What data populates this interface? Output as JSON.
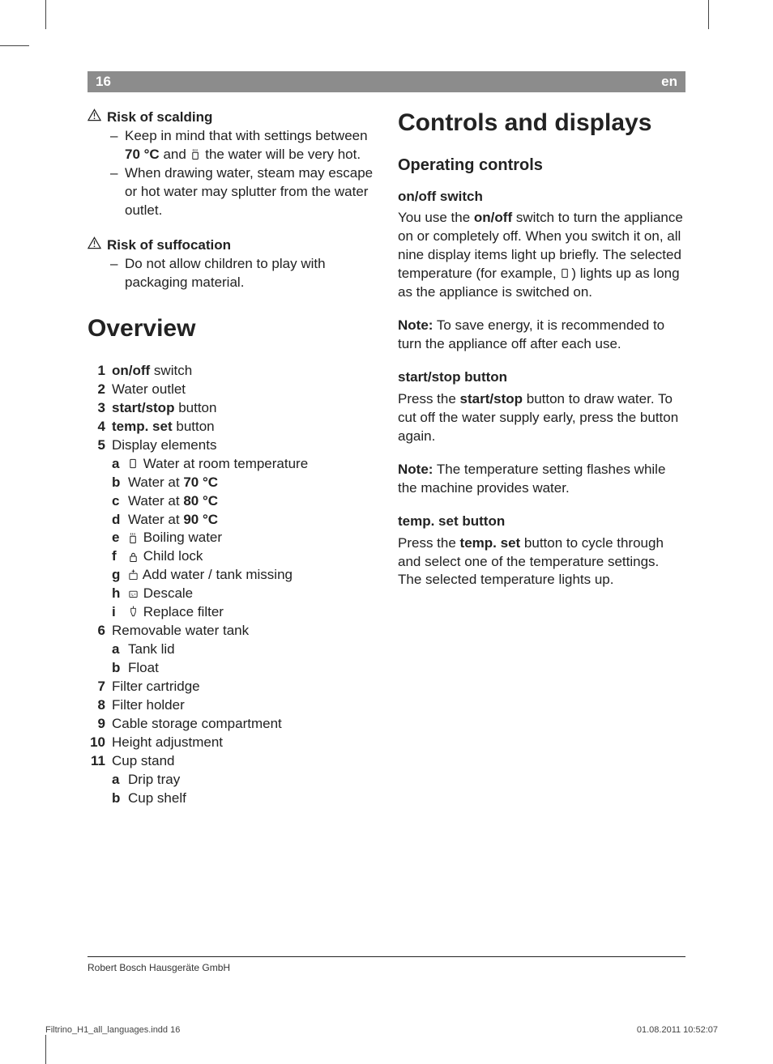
{
  "header": {
    "page_num": "16",
    "lang": "en"
  },
  "warnings": {
    "scalding": {
      "title": "Risk of scalding",
      "items": [
        {
          "pre": "Keep in mind that with settings between ",
          "bold1": "70 °C",
          "mid": " and ",
          "icon": "boiling",
          "post": " the water will be very hot."
        },
        {
          "full": "When drawing water, steam may escape or hot water may splutter from the water outlet."
        }
      ]
    },
    "suffocation": {
      "title": "Risk of suffocation",
      "items": [
        {
          "full": "Do not allow children to play with packaging material."
        }
      ]
    }
  },
  "overview": {
    "heading": "Overview",
    "items": [
      {
        "n": "1",
        "bold": "on/off",
        "rest": " switch"
      },
      {
        "n": "2",
        "rest": "Water outlet"
      },
      {
        "n": "3",
        "bold": "start/stop",
        "rest": " button"
      },
      {
        "n": "4",
        "bold": "temp. set",
        "rest": " button"
      },
      {
        "n": "5",
        "rest": "Display elements",
        "sub": [
          {
            "l": "a",
            "icon": "cup",
            "rest": " Water at room temperature"
          },
          {
            "l": "b",
            "pre": "Water at ",
            "bold": "70 °C"
          },
          {
            "l": "c",
            "pre": "Water at ",
            "bold": "80 °C"
          },
          {
            "l": "d",
            "pre": "Water at ",
            "bold": "90 °C"
          },
          {
            "l": "e",
            "icon": "boiling",
            "rest": " Boiling water"
          },
          {
            "l": "f",
            "icon": "lock",
            "rest": " Child lock"
          },
          {
            "l": "g",
            "icon": "addwater",
            "rest": " Add water / tank missing"
          },
          {
            "l": "h",
            "icon": "descale",
            "rest": " Descale"
          },
          {
            "l": "i",
            "icon": "filter",
            "rest": " Replace filter"
          }
        ]
      },
      {
        "n": "6",
        "rest": "Removable water tank",
        "sub": [
          {
            "l": "a",
            "rest": "Tank lid"
          },
          {
            "l": "b",
            "rest": "Float"
          }
        ]
      },
      {
        "n": "7",
        "rest": "Filter cartridge"
      },
      {
        "n": "8",
        "rest": "Filter holder"
      },
      {
        "n": "9",
        "rest": "Cable storage compartment"
      },
      {
        "n": "10",
        "rest": "Height adjustment"
      },
      {
        "n": "11",
        "rest": "Cup stand",
        "sub": [
          {
            "l": "a",
            "rest": "Drip tray"
          },
          {
            "l": "b",
            "rest": "Cup shelf"
          }
        ]
      }
    ]
  },
  "controls": {
    "heading": "Controls and displays",
    "subheading": "Operating controls",
    "sections": [
      {
        "title": "on/off switch",
        "body_parts": [
          "You use the ",
          {
            "b": "on/off"
          },
          " switch to turn the appliance on or completely off. When you switch it on, all nine display items light up briefly. The selected temperature (for example, ",
          {
            "icon": "cup"
          },
          ") lights up as long as the appliance is switched on."
        ],
        "note_parts": [
          {
            "b": "Note:"
          },
          " To save energy, it is recommended to turn the appliance off after each use."
        ]
      },
      {
        "title": "start/stop button",
        "body_parts": [
          "Press the ",
          {
            "b": "start/stop"
          },
          " button to draw water. To cut off the water supply early, press the button again."
        ],
        "note_parts": [
          {
            "b": "Note:"
          },
          " The temperature setting flashes while the machine provides water."
        ]
      },
      {
        "title": "temp. set button",
        "body_parts": [
          "Press the ",
          {
            "b": "temp. set"
          },
          " button to cycle through and select one of the temperature settings. The selected temperature lights up."
        ]
      }
    ]
  },
  "footer": {
    "company": "Robert Bosch Hausgeräte GmbH"
  },
  "meta": {
    "file": "Filtrino_H1_all_languages.indd   16",
    "datetime": "01.08.2011   10:52:07"
  }
}
